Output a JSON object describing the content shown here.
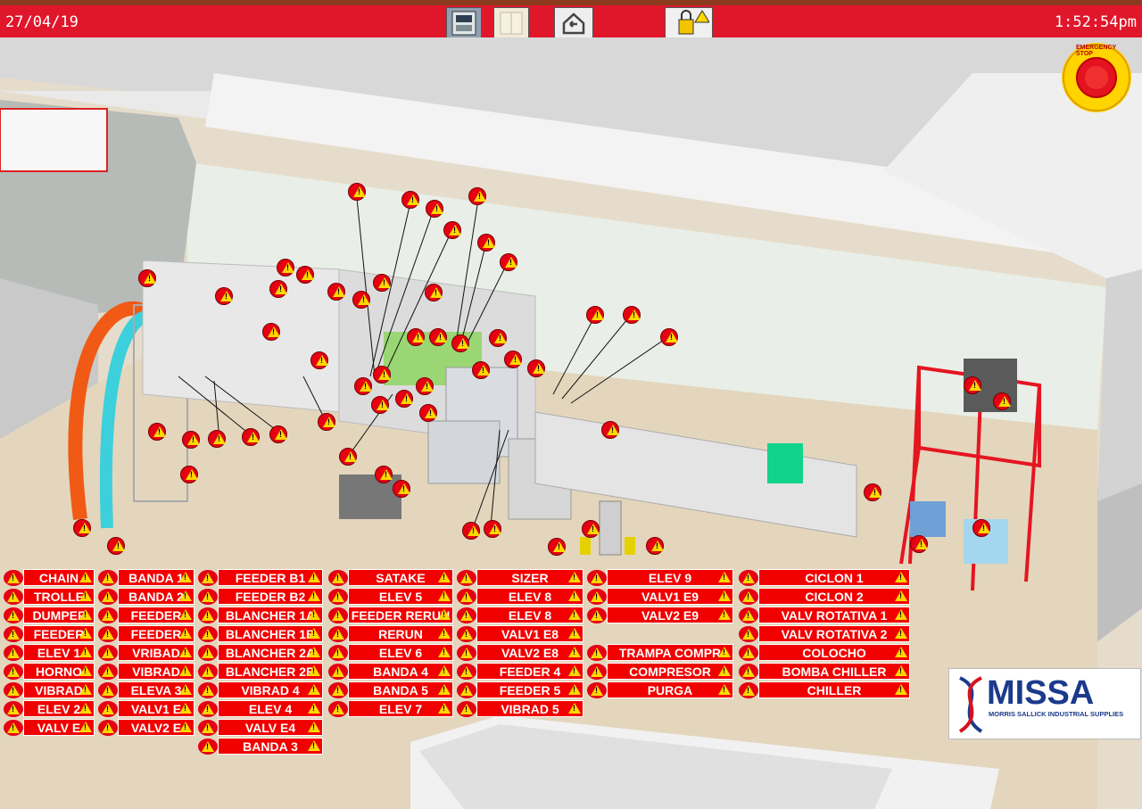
{
  "header": {
    "date": "27/04/19",
    "time": "1:52:54pm"
  },
  "emergency_stop": {
    "text": "EMERGENCY STOP"
  },
  "logo": {
    "name": "MISSA",
    "tagline": "MORRIS SALLICK INDUSTRIAL SUPPLIES"
  },
  "colors": {
    "accent": "#e0162b",
    "button": "#f20000",
    "warning": "#ffd800"
  },
  "equipment_buttons": {
    "col1": [
      "CHAIN",
      "TROLLE",
      "DUMPEF",
      "FEEDER",
      "ELEV 1",
      "HORNO",
      "VIBRAD",
      "ELEV 2",
      "VALV E"
    ],
    "col2": [
      "BANDA 1",
      "BANDA 2",
      "FEEDER",
      "FEEDER",
      "VRIBAD",
      "VIBRAD",
      "ELEVA 3",
      "VALV1 E",
      "VALV2 E"
    ],
    "col3": [
      "FEEDER B1",
      "FEEDER B2",
      "BLANCHER 1A",
      "BLANCHER 1B",
      "BLANCHER 2A",
      "BLANCHER 2B",
      "VIBRAD 4",
      "ELEV 4",
      "VALV E4",
      "BANDA 3"
    ],
    "col4": [
      "SATAKE",
      "ELEV 5",
      "FEEDER RERUN",
      "RERUN",
      "ELEV 6",
      "BANDA 4",
      "BANDA 5",
      "ELEV 7"
    ],
    "col5": [
      "SIZER",
      "ELEV 8",
      "ELEV 8",
      "VALV1 E8",
      "VALV2 E8",
      "FEEDER 4",
      "FEEDER 5",
      "VIBRAD 5"
    ],
    "col6": [
      "ELEV 9",
      "VALV1 E9",
      "VALV2 E9"
    ],
    "col6b": [
      "TRAMPA COMPR",
      "COMPRESOR",
      "PURGA"
    ],
    "col7": [
      "CICLON 1",
      "CICLON 2",
      "VALV ROTATIVA 1",
      "VALV ROTATIVA 2",
      "COLOCHO",
      "BOMBA CHILLER",
      "CHILLER"
    ]
  }
}
